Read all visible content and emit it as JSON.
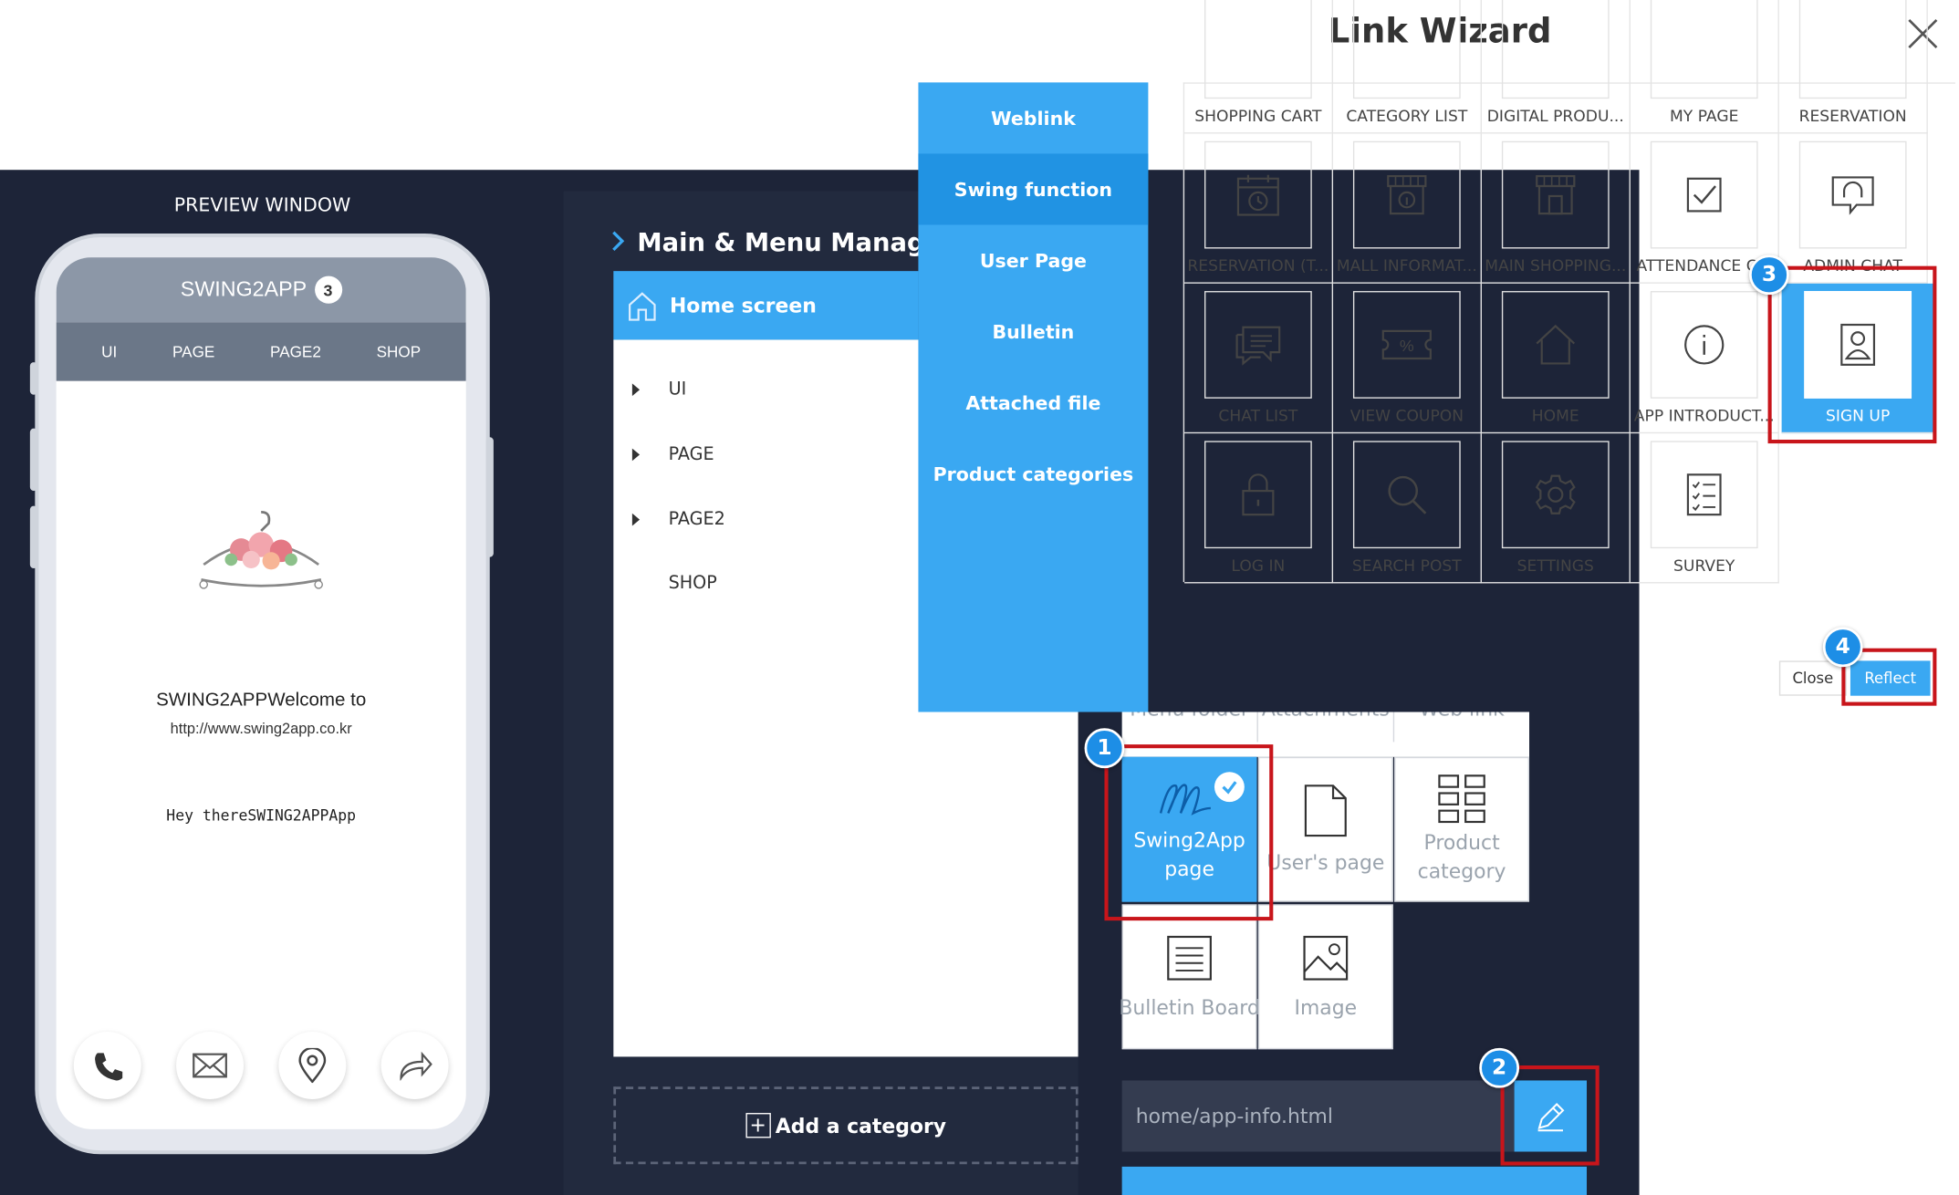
{
  "wizard": {
    "title": "Link Wizard",
    "close_icon": "close-icon"
  },
  "preview": {
    "label": "PREVIEW WINDOW",
    "app_title": "SWING2APP",
    "badge": "3",
    "menu": [
      "UI",
      "PAGE",
      "PAGE2",
      "SHOP"
    ],
    "welcome": "SWING2APPWelcome to",
    "url": "http://www.swing2app.co.kr",
    "hey": "Hey thereSWING2APPApp",
    "bottom_icons": [
      "phone-icon",
      "mail-icon",
      "map-pin-icon",
      "share-icon"
    ]
  },
  "menu_panel": {
    "title": "Main & Menu Managem",
    "home": "Home screen",
    "items": [
      "UI",
      "PAGE",
      "PAGE2",
      "SHOP"
    ],
    "add_category": "Add a category"
  },
  "link_nav": [
    "Weblink",
    "Swing function",
    "User Page",
    "Bulletin",
    "Attached file",
    "Product categories"
  ],
  "functions": {
    "row0": [
      "SHOPPING CART",
      "CATEGORY LIST",
      "DIGITAL PRODU...",
      "MY PAGE",
      "RESERVATION"
    ],
    "row1": [
      "RESERVATION (T...",
      "MALL INFORMAT...",
      "MAIN SHOPPING...",
      "ATTENDANCE C...",
      "ADMIN CHAT"
    ],
    "row2": [
      "CHAT LIST",
      "VIEW COUPON",
      "HOME",
      "APP INTRODUCT...",
      "SIGN UP"
    ],
    "row3": [
      "LOG IN",
      "SEARCH POST",
      "SETTINGS",
      "SURVEY"
    ]
  },
  "buttons": {
    "close": "Close",
    "reflect": "Reflect"
  },
  "link_types": {
    "top_row": [
      "Menu folder",
      "Attachments",
      "Web link"
    ],
    "swing2app": "Swing2App page",
    "users_page": "User's page",
    "product_category": "Product category",
    "bulletin_board": "Bulletin Board",
    "image": "Image"
  },
  "link_field": {
    "value": "home/app-info.html"
  },
  "steps": [
    "1",
    "2",
    "3",
    "4"
  ],
  "colors": {
    "accent": "#3aa8f2",
    "dark": "#1d2438",
    "highlight": "#c8151b"
  }
}
